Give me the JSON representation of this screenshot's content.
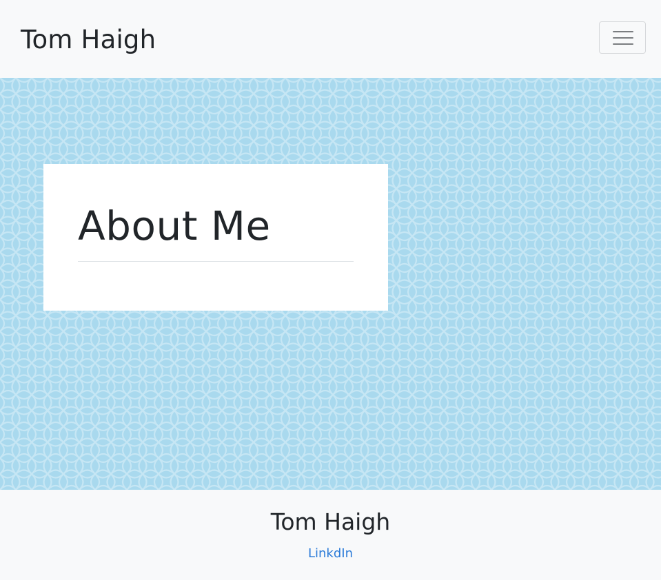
{
  "navbar": {
    "brand": "Tom Haigh",
    "toggler_icon": "hamburger-menu-icon"
  },
  "hero": {
    "background_color": "#a9d9ee",
    "pattern_color": "#c9e8f5",
    "card": {
      "heading": "About Me"
    }
  },
  "footer": {
    "name": "Tom Haigh",
    "link_label": "LinkdIn",
    "link_color": "#2b7bd8"
  }
}
